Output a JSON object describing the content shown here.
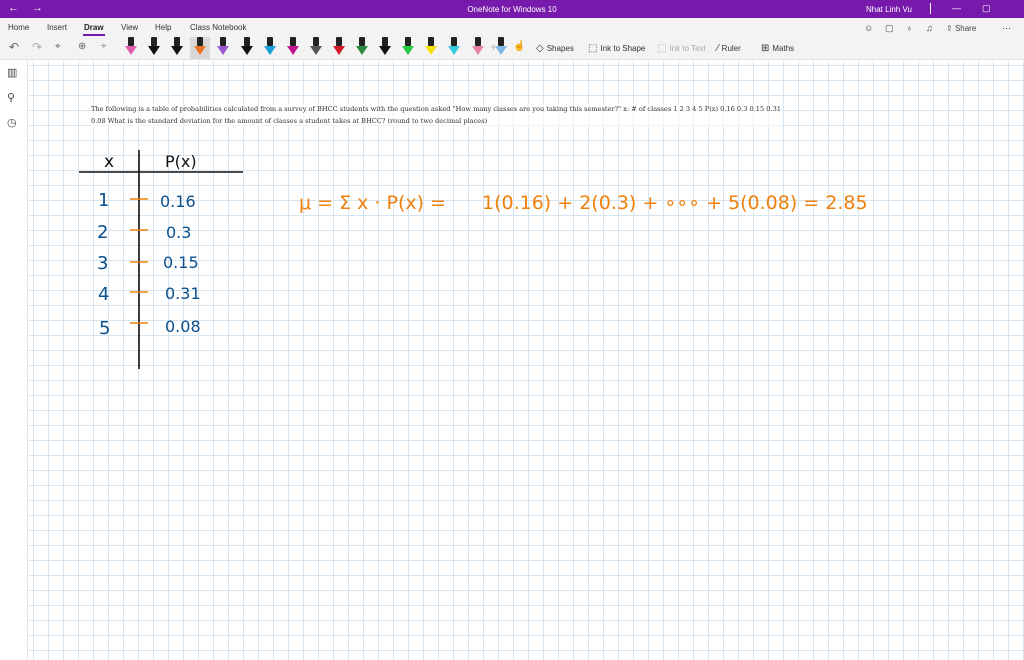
{
  "window": {
    "title": "OneNote for Windows 10",
    "user": "Nhat Linh Vu",
    "back_glyph": "←",
    "forward_glyph": "→",
    "minimize_glyph": "—",
    "restore_glyph": "▢"
  },
  "ribbon": {
    "tabs": [
      "Home",
      "Insert",
      "Draw",
      "View",
      "Help",
      "Class Notebook"
    ],
    "active_tab": "Draw",
    "right_actions": {
      "share_label": "Share"
    },
    "tools": {
      "shapes": "Shapes",
      "ink_to_shape": "Ink to Shape",
      "ink_to_text": "Ink to Text",
      "ruler": "Ruler",
      "maths": "Maths"
    },
    "pen_colors": [
      "#e05ab0",
      "#111111",
      "#111111",
      "#e8742c",
      "#9b59d0",
      "#111111",
      "#1aa0d8",
      "#c0148c",
      "#555555",
      "#d21c2a",
      "#2b8a3e",
      "#111111",
      "#27c83c",
      "#f5e100",
      "#38c8e0",
      "#e87fa8",
      "#7fb8e8"
    ],
    "selected_pen_index": 3
  },
  "page": {
    "question": "The following is a table of probabilities calculated from a survey of BHCC students with the question asked \"How many classes are you taking this semester?\" x: # of classes 1 2 3 4 5 P(x) 0.16 0.3 0.15 0.31 0.08 What is the standard deviation for the amount of classes a student takes at BHCC? (round to two decimal places)"
  },
  "handwriting": {
    "table": {
      "headers": [
        "x",
        "P(x)"
      ],
      "x_values": [
        "1",
        "2",
        "3",
        "4",
        "5"
      ],
      "p_values": [
        "0.16",
        "0.3",
        "0.15",
        "0.31",
        "0.08"
      ]
    },
    "mean_equation": {
      "lhs": "μ = Σ x · P(x) =",
      "expansion": "1(0.16) + 2(0.3) + ∘∘∘ + 5(0.08) = 2.85"
    },
    "colors": {
      "table_ink": "#0b4f8c",
      "equation_ink": "#f0800a"
    }
  }
}
